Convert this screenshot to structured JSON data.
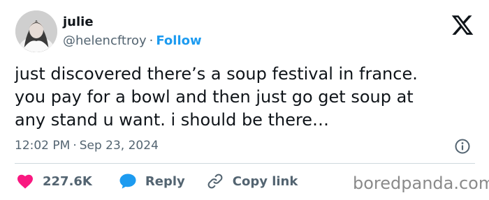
{
  "user": {
    "display_name": "julie",
    "handle": "@helencftroy",
    "separator": "·",
    "follow_label": "Follow"
  },
  "tweet": {
    "lines": [
      "just discovered there’s a soup festival in france.",
      "you pay for a bowl and then just go get soup at",
      "any stand u want. i should be there…"
    ]
  },
  "meta": {
    "time": "12:02 PM",
    "separator": "·",
    "date": "Sep 23, 2024"
  },
  "actions": {
    "likes": "227.6K",
    "reply_label": "Reply",
    "copy_link_label": "Copy link"
  },
  "watermark": "boredpanda.com",
  "colors": {
    "like": "#f91880",
    "reply": "#1d9bf0",
    "follow": "#1d9bf0",
    "text": "#0f1419",
    "muted": "#536471"
  },
  "icons": {
    "logo": "x-logo-icon",
    "info": "info-icon",
    "like": "heart-icon",
    "reply": "speech-bubble-icon",
    "copy": "link-icon"
  }
}
